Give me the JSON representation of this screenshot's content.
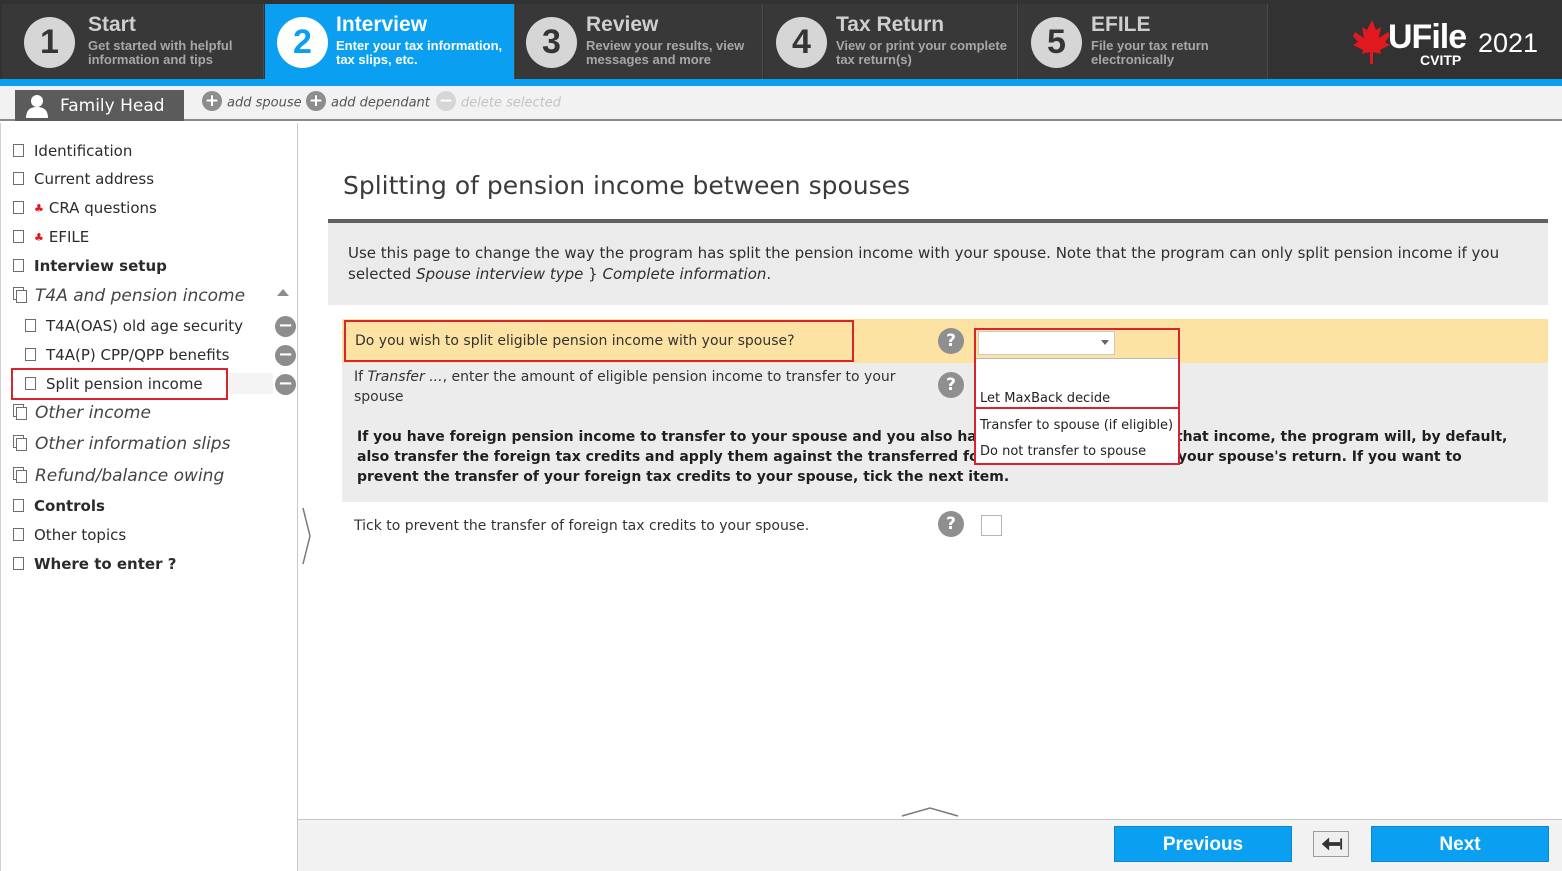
{
  "steps": [
    {
      "num": "1",
      "title": "Start",
      "desc": "Get started with helpful information and tips",
      "active": false
    },
    {
      "num": "2",
      "title": "Interview",
      "desc": "Enter your tax information, tax slips, etc.",
      "active": true
    },
    {
      "num": "3",
      "title": "Review",
      "desc": "Review your results, view messages and more",
      "active": false
    },
    {
      "num": "4",
      "title": "Tax Return",
      "desc": "View or print your complete tax return(s)",
      "active": false
    },
    {
      "num": "5",
      "title": "EFILE",
      "desc": "File your tax return electronically",
      "active": false
    }
  ],
  "logo": {
    "brand": "UFile",
    "year": "2021",
    "sub": "CVITP"
  },
  "family": {
    "tab": "Family Head",
    "add_spouse": "add spouse",
    "add_dependant": "add dependant",
    "delete_selected": "delete selected"
  },
  "sidebar": {
    "items": [
      {
        "label": "Identification"
      },
      {
        "label": "Current address"
      },
      {
        "label": "CRA questions"
      },
      {
        "label": "EFILE"
      },
      {
        "label": "Interview setup"
      },
      {
        "label": "T4A and pension income"
      },
      {
        "label": "T4A(OAS) old age security"
      },
      {
        "label": "T4A(P) CPP/QPP benefits"
      },
      {
        "label": "Split pension income"
      },
      {
        "label": "Other income"
      },
      {
        "label": "Other information slips"
      },
      {
        "label": "Refund/balance owing"
      },
      {
        "label": "Controls"
      },
      {
        "label": "Other topics"
      },
      {
        "label": "Where to enter ?"
      }
    ]
  },
  "page": {
    "title": "Splitting of pension income between spouses",
    "intro_a": "Use this page to change the way the program has split the pension income with your spouse. Note that the program can only split pension income if you selected ",
    "intro_b": "Spouse interview type",
    "intro_c": " } ",
    "intro_d": "Complete information",
    "intro_e": ".",
    "q1": "Do you wish to split eligible pension income with your spouse?",
    "q2_a": "If ",
    "q2_b": "Transfer ...",
    "q2_c": ", enter the amount of eligible pension income to transfer to your spouse",
    "warning": "If you have foreign pension income to transfer to your spouse and you also have foreign tax credits on that income, the program will, by default, also transfer the foreign tax credits and apply them against the transferred foreign pension income on your spouse's return. If you want to prevent the transfer of your foreign tax credits to your spouse, tick the next item.",
    "q3": "Tick to prevent the transfer of foreign tax credits to your spouse.",
    "help_glyph": "?"
  },
  "dropdown": {
    "selected": "",
    "options": [
      "",
      "Let MaxBack decide",
      "Transfer to spouse (if eligible)",
      "Do not transfer to spouse"
    ]
  },
  "buttons": {
    "previous": "Previous",
    "next": "Next"
  },
  "colors": {
    "accent": "#0a9ff0",
    "highlight": "#fde3a3",
    "annotation": "#d9232d"
  }
}
